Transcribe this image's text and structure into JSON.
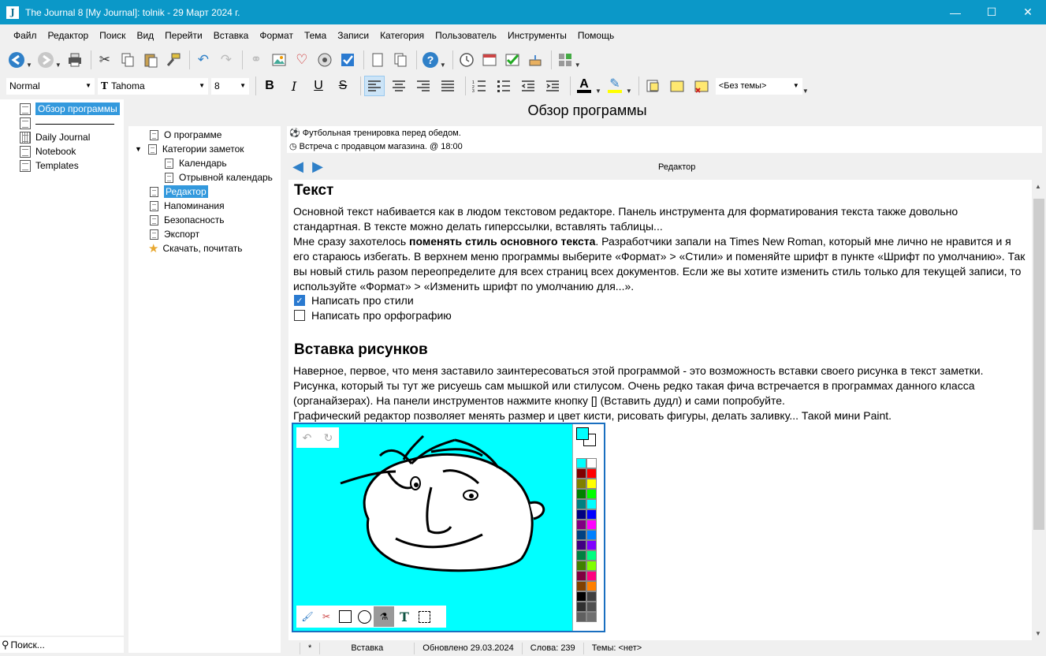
{
  "window": {
    "title": "The Journal 8 [My Journal]: tolnik - 29 Март 2024 г."
  },
  "menu": [
    "Файл",
    "Редактор",
    "Поиск",
    "Вид",
    "Перейти",
    "Вставка",
    "Формат",
    "Тема",
    "Записи",
    "Категория",
    "Пользователь",
    "Инструменты",
    "Помощь"
  ],
  "format_bar": {
    "style": "Normal",
    "font": "Tahoma",
    "size": "8",
    "topic": "<Без темы>"
  },
  "left_pane": {
    "items": [
      "Обзор программы",
      "",
      "Daily Journal",
      "Notebook",
      "Templates"
    ],
    "search_placeholder": "Поиск..."
  },
  "main_title": "Обзор программы",
  "tree": {
    "items": [
      "О программе",
      "Категории заметок",
      "Календарь",
      "Отрывной календарь",
      "Редактор",
      "Напоминания",
      "Безопасность",
      "Экспорт",
      "Скачать, почитать"
    ]
  },
  "reminders": [
    "Футбольная тренировка перед обедом.",
    "Встреча с продавцом магазина. @ 18:00"
  ],
  "editor_label": "Редактор",
  "doc": {
    "h1": "Текст",
    "p1": "Основной текст набивается как в людом текстовом редакторе. Панель инструмента для форматирования текста также довольно стандартная. В тексте можно делать гиперссылки, вставлять таблицы...",
    "p2_pre": "Мне сразу захотелось ",
    "p2_bold": "поменять стиль основного текста",
    "p2_post": ". Разработчики запали на Times New Roman, который мне лично не нравится и я его стараюсь избегать. В верхнем меню программы выберите «Формат» > «Стили» и поменяйте шрифт в пункте «Шрифт по умолчанию». Так вы новый стиль разом переопределите для всех страниц всех документов. Если же вы хотите изменить стиль только для текущей записи, то используйте «Формат» > «Изменить шрифт по умолчанию для...».",
    "check1": "Написать про стили",
    "check2": "Написать про орфографию",
    "h2": "Вставка рисунков",
    "p3": "Наверное, первое, что меня заставило заинтересоваться этой программой - это возможность вставки своего рисунка в текст заметки. Рисунка, который ты тут же рисуешь сам мышкой или стилусом. Очень редко такая фича встречается в программах данного класса (органайзерах). На панели инструментов нажмите кнопку [] (Вставить дудл) и сами попробуйте.",
    "p4": "Графический редактор позволяет менять размер и цвет кисти, рисовать фигуры, делать заливку... Такой мини Paint."
  },
  "status": {
    "mark": "*",
    "mode": "Вставка",
    "updated": "Обновлено 29.03.2024",
    "words": "Слова: 239",
    "topics": "Темы: <нет>"
  },
  "palette": [
    "#00ffff",
    "#ffffff",
    "#800000",
    "#ff0000",
    "#808000",
    "#ffff00",
    "#008000",
    "#00ff00",
    "#008080",
    "#00ffff",
    "#000080",
    "#0000ff",
    "#800080",
    "#ff00ff",
    "#004080",
    "#0080ff",
    "#400080",
    "#8000ff",
    "#008040",
    "#00ff80",
    "#408000",
    "#80ff00",
    "#800040",
    "#ff0080",
    "#804000",
    "#ff8000",
    "#000000",
    "#404040",
    "#303030",
    "#505050",
    "#606060",
    "#707070"
  ]
}
